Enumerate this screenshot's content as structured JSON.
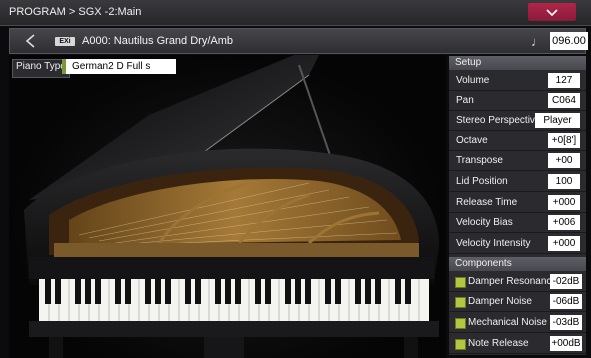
{
  "title_bar": {
    "title": "PROGRAM > SGX -2:Main"
  },
  "program_bar": {
    "badge": "EXi",
    "program_name": "A000: Nautilus Grand Dry/Amb",
    "tempo": "096.00"
  },
  "piano_type": {
    "label": "Piano Type",
    "value": "German2 D Full s"
  },
  "setup": {
    "heading": "Setup",
    "rows": [
      {
        "label": "Volume",
        "value": "127"
      },
      {
        "label": "Pan",
        "value": "C064"
      },
      {
        "label": "Stereo Perspective",
        "value": "Player"
      },
      {
        "label": "Octave",
        "value": "+0[8']"
      },
      {
        "label": "Transpose",
        "value": "+00"
      },
      {
        "label": "Lid Position",
        "value": "100"
      },
      {
        "label": "Release Time",
        "value": "+000"
      },
      {
        "label": "Velocity Bias",
        "value": "+006"
      },
      {
        "label": "Velocity Intensity",
        "value": "+000"
      }
    ]
  },
  "components": {
    "heading": "Components",
    "rows": [
      {
        "label": "Damper Resonance",
        "value": "-02dB",
        "checked": true
      },
      {
        "label": "Damper Noise",
        "value": "-06dB",
        "checked": true
      },
      {
        "label": "Mechanical Noise",
        "value": "-03dB",
        "checked": true
      },
      {
        "label": "Note Release",
        "value": "+00dB",
        "checked": true
      }
    ]
  },
  "colors": {
    "accent": "#a02044",
    "checkbox": "#b5c640"
  }
}
